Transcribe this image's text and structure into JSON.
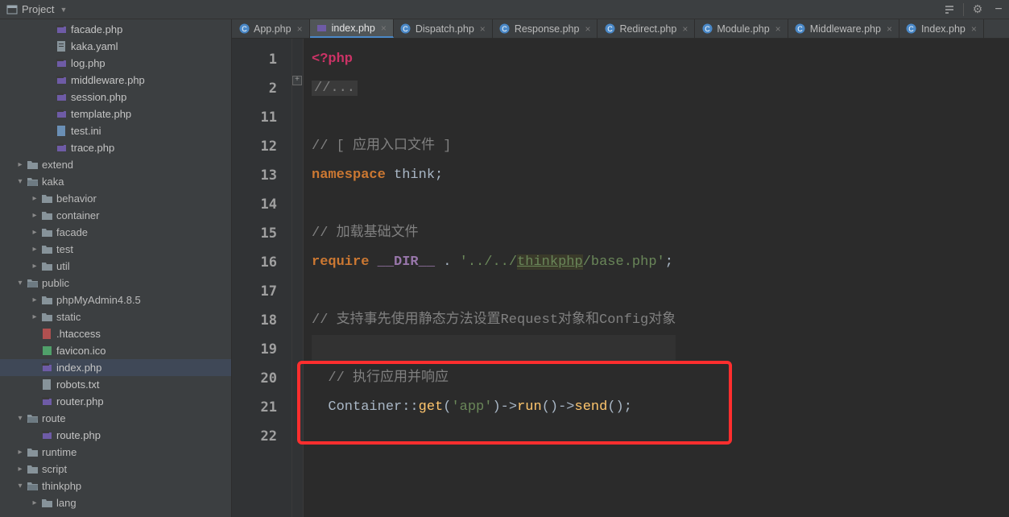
{
  "projectPanel": {
    "label": "Project"
  },
  "toolbar": {
    "gearTitle": "Settings",
    "collapseTitle": "Collapse"
  },
  "tree": [
    {
      "type": "file",
      "name": "facade.php",
      "depth": 3,
      "icon": "php"
    },
    {
      "type": "file",
      "name": "kaka.yaml",
      "depth": 3,
      "icon": "yaml"
    },
    {
      "type": "file",
      "name": "log.php",
      "depth": 3,
      "icon": "php"
    },
    {
      "type": "file",
      "name": "middleware.php",
      "depth": 3,
      "icon": "php"
    },
    {
      "type": "file",
      "name": "session.php",
      "depth": 3,
      "icon": "php"
    },
    {
      "type": "file",
      "name": "template.php",
      "depth": 3,
      "icon": "php"
    },
    {
      "type": "file",
      "name": "test.ini",
      "depth": 3,
      "icon": "ini"
    },
    {
      "type": "file",
      "name": "trace.php",
      "depth": 3,
      "icon": "php"
    },
    {
      "type": "folder",
      "name": "extend",
      "depth": 1,
      "state": "closed"
    },
    {
      "type": "folder",
      "name": "kaka",
      "depth": 1,
      "state": "open"
    },
    {
      "type": "folder",
      "name": "behavior",
      "depth": 2,
      "state": "closed"
    },
    {
      "type": "folder",
      "name": "container",
      "depth": 2,
      "state": "closed"
    },
    {
      "type": "folder",
      "name": "facade",
      "depth": 2,
      "state": "closed"
    },
    {
      "type": "folder",
      "name": "test",
      "depth": 2,
      "state": "closed"
    },
    {
      "type": "folder",
      "name": "util",
      "depth": 2,
      "state": "closed"
    },
    {
      "type": "folder",
      "name": "public",
      "depth": 1,
      "state": "open"
    },
    {
      "type": "folder",
      "name": "phpMyAdmin4.8.5",
      "depth": 2,
      "state": "closed"
    },
    {
      "type": "folder",
      "name": "static",
      "depth": 2,
      "state": "closed"
    },
    {
      "type": "file",
      "name": ".htaccess",
      "depth": 2,
      "icon": "htaccess"
    },
    {
      "type": "file",
      "name": "favicon.ico",
      "depth": 2,
      "icon": "ico"
    },
    {
      "type": "file",
      "name": "index.php",
      "depth": 2,
      "icon": "php",
      "selected": true
    },
    {
      "type": "file",
      "name": "robots.txt",
      "depth": 2,
      "icon": "txt"
    },
    {
      "type": "file",
      "name": "router.php",
      "depth": 2,
      "icon": "php"
    },
    {
      "type": "folder",
      "name": "route",
      "depth": 1,
      "state": "open"
    },
    {
      "type": "file",
      "name": "route.php",
      "depth": 2,
      "icon": "php"
    },
    {
      "type": "folder",
      "name": "runtime",
      "depth": 1,
      "state": "closed"
    },
    {
      "type": "folder",
      "name": "script",
      "depth": 1,
      "state": "closed"
    },
    {
      "type": "folder",
      "name": "thinkphp",
      "depth": 1,
      "state": "open"
    },
    {
      "type": "folder",
      "name": "lang",
      "depth": 2,
      "state": "closed"
    }
  ],
  "tabs": [
    {
      "label": "App.php",
      "icon": "class",
      "active": false
    },
    {
      "label": "index.php",
      "icon": "php",
      "active": true
    },
    {
      "label": "Dispatch.php",
      "icon": "class",
      "active": false
    },
    {
      "label": "Response.php",
      "icon": "class",
      "active": false
    },
    {
      "label": "Redirect.php",
      "icon": "class",
      "active": false
    },
    {
      "label": "Module.php",
      "icon": "class",
      "active": false
    },
    {
      "label": "Middleware.php",
      "icon": "class",
      "active": false
    },
    {
      "label": "Index.php",
      "icon": "class",
      "active": false
    }
  ],
  "lineNumbers": [
    "1",
    "2",
    "11",
    "12",
    "13",
    "14",
    "15",
    "16",
    "17",
    "18",
    "19",
    "20",
    "21",
    "22"
  ],
  "code": {
    "l1": "<?php",
    "l2": "//...",
    "l12": "// [ 应用入口文件 ]",
    "l13_ns": "namespace",
    "l13_ident": " think;",
    "l15": "// 加载基础文件",
    "l16_req": "require",
    "l16_magic": " __DIR__ ",
    "l16_dot": ". ",
    "l16_str1": "'../../",
    "l16_link": "thinkphp",
    "l16_str2": "/base.php'",
    "l16_semi": ";",
    "l18": "// 支持事先使用静态方法设置Request对象和Config对象",
    "l20": "// 执行应用并响应",
    "l21_a": "Container",
    "l21_b": "::",
    "l21_c": "get",
    "l21_d": "(",
    "l21_e": "'app'",
    "l21_f": ")->",
    "l21_g": "run",
    "l21_h": "()->",
    "l21_i": "send",
    "l21_j": "();"
  },
  "foldMarker": "+"
}
